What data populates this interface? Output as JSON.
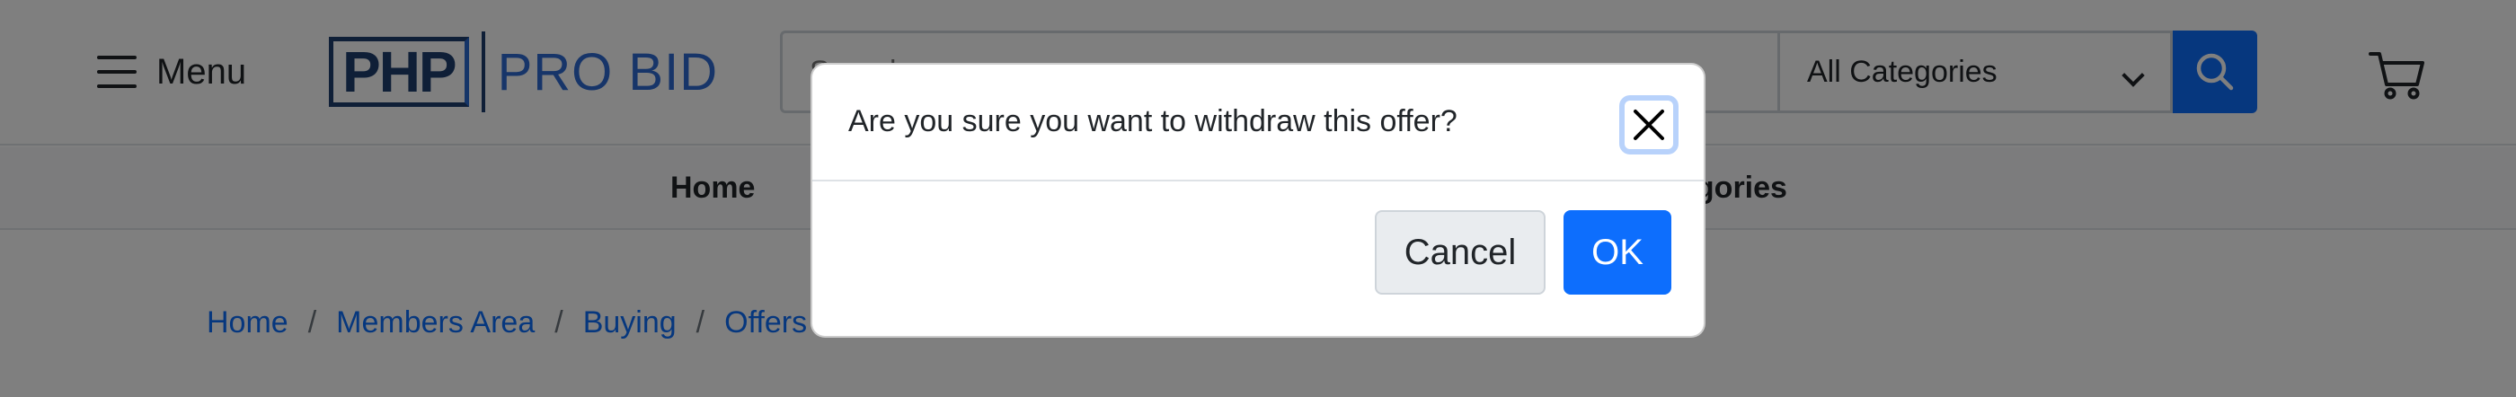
{
  "header": {
    "menu_label": "Menu",
    "logo": {
      "php": "PHP",
      "pro_bid": "PRO BID"
    },
    "search": {
      "placeholder": "Search",
      "category": "All Categories"
    }
  },
  "nav": {
    "items": [
      {
        "label": "Home"
      },
      {
        "label": "egories"
      }
    ]
  },
  "breadcrumb": {
    "items": [
      "Home",
      "Members Area",
      "Buying",
      "Offers"
    ],
    "separator": "/"
  },
  "modal": {
    "message": "Are you sure you want to withdraw this offer?",
    "cancel_label": "Cancel",
    "ok_label": "OK"
  },
  "colors": {
    "primary": "#0d6efd",
    "brand_dark": "#1f3e6e",
    "backdrop": "rgba(0,0,0,0.5)"
  }
}
